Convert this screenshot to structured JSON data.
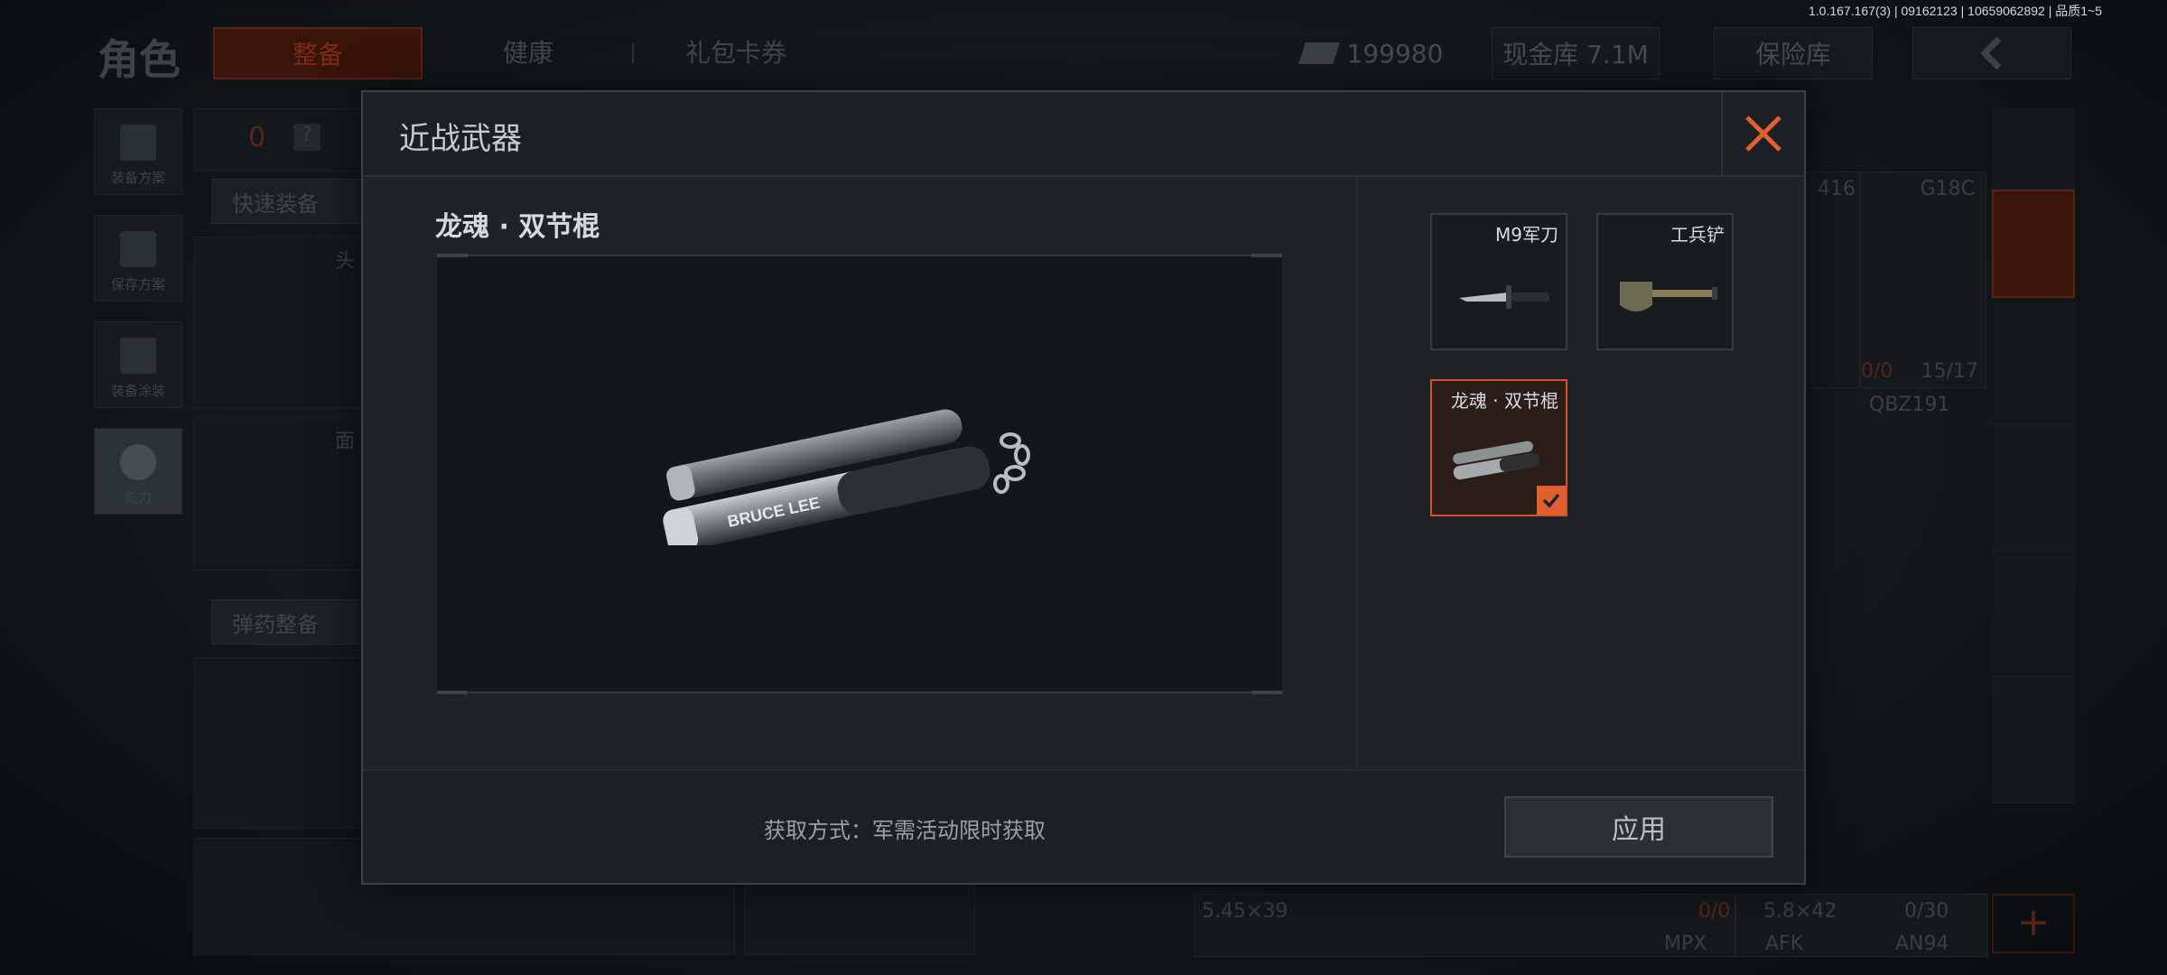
{
  "build_info": "1.0.167.167(3) | 09162123 | 10659062892 | 品质1~5",
  "background": {
    "page_title": "角色",
    "tabs": [
      {
        "label": "整备"
      },
      {
        "label": "健康"
      },
      {
        "label": "礼包卡券"
      }
    ],
    "coins": "199980",
    "cash_vault": "现金库 7.1M",
    "insurance": "保险库",
    "left_rail": [
      {
        "label": "装备方案"
      },
      {
        "label": "保存方案"
      },
      {
        "label": "装备涂装"
      },
      {
        "label": "能力"
      }
    ],
    "armor_count": "0",
    "help_label": "?",
    "quick_equip": "快速装备",
    "ammo_prep": "弹药整备",
    "slot_head": "头",
    "slot_face": "面",
    "weapon_cards": {
      "g18c": "G18C",
      "w416": "416",
      "ammo_counter_left": "0/0",
      "ammo_counter_right": "15/17",
      "qbz": "QBZ191",
      "caliber_1": "5.45×39",
      "ammo_1": "0/0",
      "caliber_2": "5.8×42",
      "ammo_2": "0/30",
      "mpx": "MPX",
      "akm": "AFK",
      "an94": "AN94"
    },
    "plus": "+"
  },
  "modal": {
    "title": "近战武器",
    "selected_name": "龙魂 · 双节棍",
    "items": [
      {
        "label": "M9军刀",
        "icon": "knife-icon",
        "selected": false
      },
      {
        "label": "工兵铲",
        "icon": "shovel-icon",
        "selected": false
      },
      {
        "label": "龙魂 · 双节棍",
        "icon": "nunchaku-icon",
        "selected": true
      }
    ],
    "acquire_text": "获取方式：军需活动限时获取",
    "apply_label": "应用",
    "nunchaku_brand": "BRUCE LEE"
  },
  "colors": {
    "accent": "#e2602f",
    "modal_bg": "#1d2327",
    "text": "#c9d0d4"
  }
}
